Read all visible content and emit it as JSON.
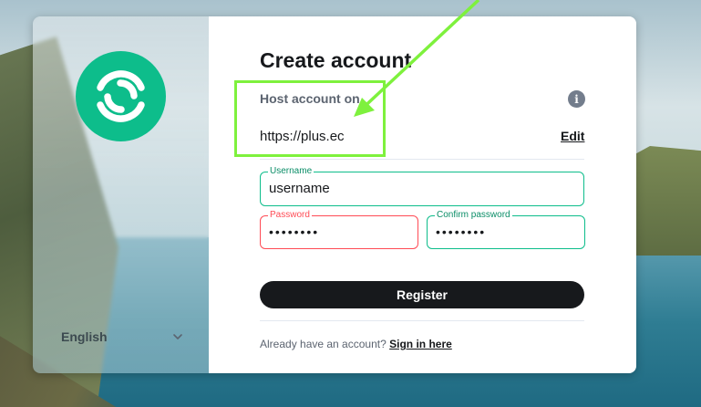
{
  "form": {
    "title": "Create account",
    "host_label": "Host account on",
    "host_url": "https://plus.ec",
    "edit_label": "Edit",
    "info_glyph": "i",
    "username": {
      "label": "Username",
      "value": "username"
    },
    "password": {
      "label": "Password",
      "value": "••••••••"
    },
    "confirm_password": {
      "label": "Confirm password",
      "value": "••••••••"
    },
    "register_label": "Register",
    "signin_prompt": "Already have an account?",
    "signin_link": "Sign in here"
  },
  "sidebar": {
    "language": "English",
    "logo_icon": "element-logo-icon",
    "chevron_icon": "chevron-down-icon"
  },
  "colors": {
    "brand_green": "#0dbd8b",
    "error_red": "#ff4b55",
    "button_dark": "#17191c",
    "annotation_green": "#7ef13d"
  }
}
